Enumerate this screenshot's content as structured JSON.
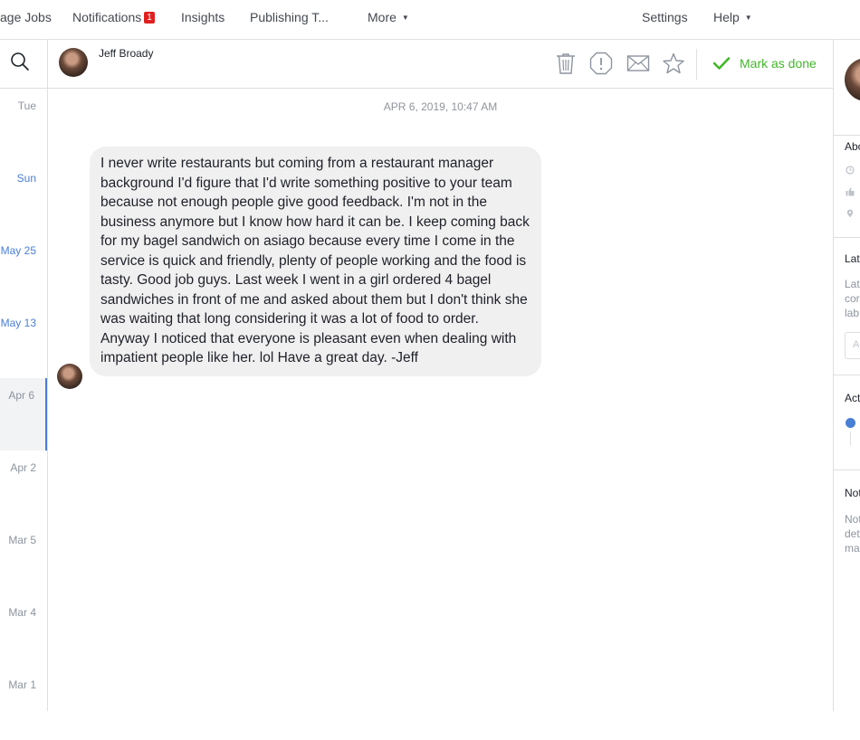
{
  "nav": {
    "items": [
      {
        "label": "age Jobs"
      },
      {
        "label": "Notifications",
        "badge": "1"
      },
      {
        "label": "Insights"
      },
      {
        "label": "Publishing T..."
      },
      {
        "label": "More"
      }
    ],
    "settings": "Settings",
    "help": "Help"
  },
  "dates": [
    "Tue",
    "Sun",
    "May 25",
    "May 13",
    "Apr 6",
    "Apr 2",
    "Mar 5",
    "Mar 4",
    "Mar 1"
  ],
  "conversation": {
    "name": "Jeff Broady",
    "mark_done": "Mark as done",
    "timestamp": "APR 6, 2019, 10:47 AM",
    "message": "I never write restaurants but coming from a restaurant manager background I'd figure that I'd write something positive to your team because not enough people give good feedback. I'm not in the business anymore but I know how hard it can be. I keep coming back for my bagel sandwich on asiago because every time I come in the service is quick and friendly, plenty of people working and the food is tasty. Good job guys. Last week I went in a girl ordered 4 bagel sandwiches in front of me and asked about them but I don't think she was waiting that long considering it was a lot of food to order. Anyway I noticed that everyone is pleasant even when dealing with impatient people like her. lol Have a great day. -Jeff"
  },
  "right_panel": {
    "about": "Abo",
    "labels": "Lat",
    "labels_desc": [
      "Lat",
      "cor",
      "lab"
    ],
    "labels_input": "A",
    "activity": "Act",
    "notes": "Not",
    "notes_desc": [
      "Not",
      "det",
      "ma"
    ]
  },
  "colors": {
    "accent_blue": "#4a7fd6",
    "done_green": "#42b72a",
    "badge_red": "#e02020",
    "bubble_bg": "#f1f0f0"
  }
}
